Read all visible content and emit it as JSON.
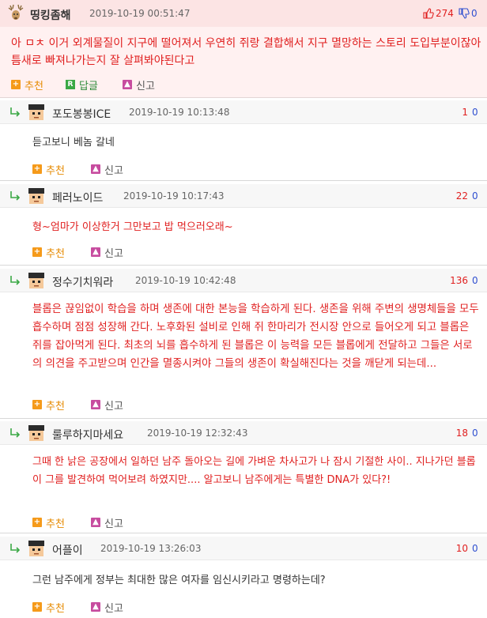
{
  "top_comment": {
    "nickname": "띵킹좀해",
    "date": "2019-10-19 00:51:47",
    "upvotes": "274",
    "downvotes": "0",
    "body": "아 ㅁㅊ 이거 외계물질이 지구에 떨어져서 우연히 쥐랑 결합해서 지구 멸망하는 스토리 도입부분이잖아 틈새로 빠져나가는지 잘 살펴봐야된다고",
    "recommend_label": "추천",
    "reply_label": "답글",
    "report_label": "신고",
    "reply_icon_letter": "R"
  },
  "comments": [
    {
      "nickname": "포도봉봉ICE",
      "date": "2019-10-19 10:13:48",
      "upvotes": "1",
      "downvotes": "0",
      "body": "듣고보니 베놈 갈네",
      "recommend_label": "추천",
      "report_label": "신고"
    },
    {
      "nickname": "페러노이드",
      "date": "2019-10-19 10:17:43",
      "upvotes": "22",
      "downvotes": "0",
      "body": "형~엄마가 이상한거 그만보고 밥 먹으러오래~",
      "recommend_label": "추천",
      "report_label": "신고"
    },
    {
      "nickname": "정수기치워라",
      "date": "2019-10-19 10:42:48",
      "upvotes": "136",
      "downvotes": "0",
      "body": "블롭은 끊임없이 학습을 하며 생존에 대한 본능을 학습하게 된다. 생존을 위해 주변의 생명체들을 모두 흡수하며 점점 성장해 간다. 노후화된 설비로 인해 쥐 한마리가 전시장 안으로 들어오게 되고 블롭은 쥐를 잡아먹게 된다. 최초의 뇌를 흡수하게 된 블롭은 이 능력을 모든 블롭에게 전달하고 그들은 서로의 의견을 주고받으며 인간을 멸종시켜야 그들의 생존이 확실해진다는 것을 깨닫게 되는데...",
      "recommend_label": "추천",
      "report_label": "신고"
    },
    {
      "nickname": "룰루하지마세요",
      "date": "2019-10-19 12:32:43",
      "upvotes": "18",
      "downvotes": "0",
      "body": "그때 한 낡은 공장에서 일하던 남주 돌아오는 길에 가벼운 차사고가 나 잠시 기절한 사이.. 지나가던 블롭이 그를 발견하여 먹어보려 하였지만.... 알고보니 남주에게는 특별한 DNA가 있다?!",
      "recommend_label": "추천",
      "report_label": "신고"
    },
    {
      "nickname": "어플이",
      "date": "2019-10-19 13:26:03",
      "upvotes": "10",
      "downvotes": "0",
      "body": "그런 남주에게 정부는 최대한 많은 여자를 임신시키라고 명령하는데?",
      "recommend_label": "추천",
      "report_label": "신고"
    }
  ],
  "colors": {
    "upvote": "#e02020",
    "downvote": "#3050d0",
    "recommend": "#e68a00",
    "top_bg": "#fff1f1"
  },
  "icons": [
    "deer-avatar-icon",
    "thumbs-up-icon",
    "thumbs-down-icon",
    "plus-icon",
    "reply-badge-icon",
    "report-icon",
    "reply-arrow-icon",
    "pixel-avatar-icon"
  ]
}
